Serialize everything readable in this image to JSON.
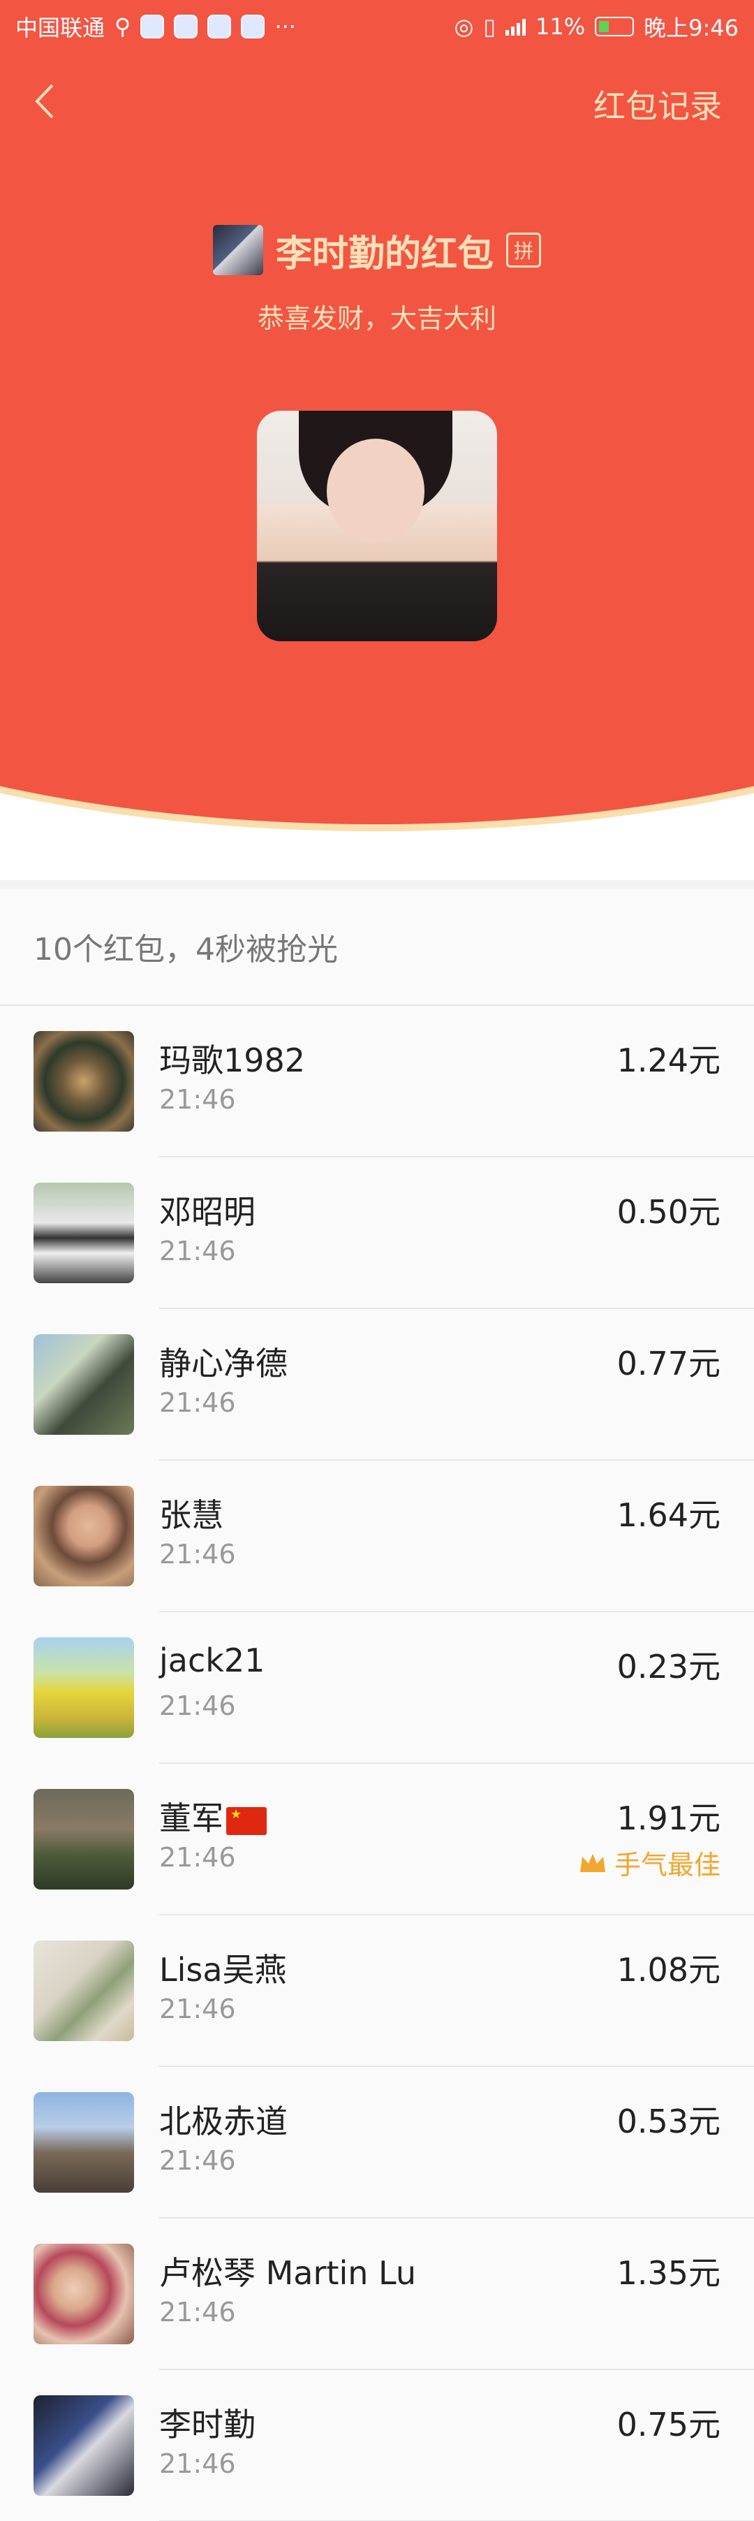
{
  "status_bar": {
    "carrier": "中国联通",
    "battery": "11%",
    "time": "晚上9:46",
    "more": "···"
  },
  "nav": {
    "records_label": "红包记录"
  },
  "sender": {
    "title": "李时勤的红包",
    "pin_label": "拼",
    "greeting": "恭喜发财，大吉大利"
  },
  "summary": "10个红包，4秒被抢光",
  "recipients": [
    {
      "name": "玛歌1982",
      "time": "21:46",
      "amount": "1.24元"
    },
    {
      "name": "邓昭明",
      "time": "21:46",
      "amount": "0.50元"
    },
    {
      "name": "静心净德",
      "time": "21:46",
      "amount": "0.77元"
    },
    {
      "name": "张慧",
      "time": "21:46",
      "amount": "1.64元"
    },
    {
      "name": "jack21",
      "time": "21:46",
      "amount": "0.23元"
    },
    {
      "name": "董军",
      "time": "21:46",
      "amount": "1.91元",
      "badge": "手气最佳"
    },
    {
      "name": "Lisa吴燕",
      "time": "21:46",
      "amount": "1.08元"
    },
    {
      "name": "北极赤道",
      "time": "21:46",
      "amount": "0.53元"
    },
    {
      "name": "卢松琴 Martin Lu",
      "time": "21:46",
      "amount": "1.35元"
    },
    {
      "name": "李时勤",
      "time": "21:46",
      "amount": "0.75元"
    }
  ],
  "colors": {
    "header_red": "#f35543",
    "gold_text": "#ffe1b9",
    "best_luck": "#f2a62d"
  }
}
